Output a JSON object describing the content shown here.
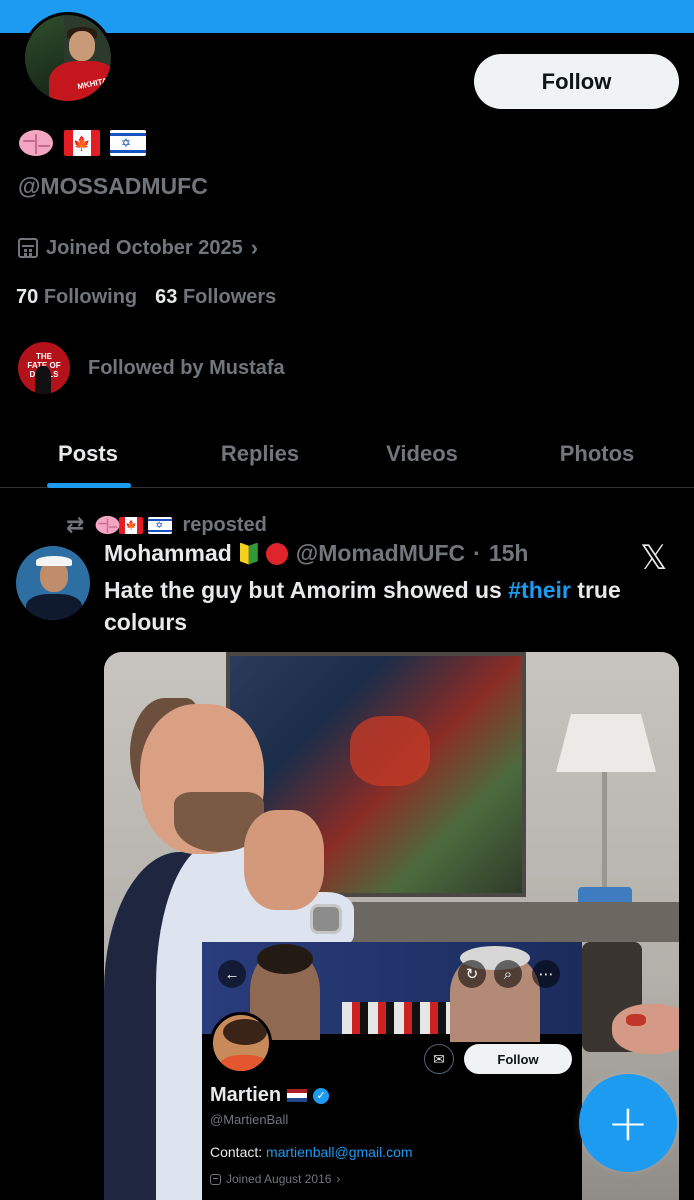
{
  "profile": {
    "display_emojis": [
      "brain",
      "canada-flag",
      "israel-flag"
    ],
    "handle": "@MOSSADMUFC",
    "avatar_shirt_text": "MKHITARYAN",
    "follow_label": "Follow",
    "joined": "Joined October 2025",
    "following_count": "70",
    "following_label": "Following",
    "followers_count": "63",
    "followers_label": "Followers",
    "followed_by": "Followed by Mustafa",
    "followed_by_avatar_text": "THE FATE OF DEVILS"
  },
  "tabs": [
    {
      "label": "Posts",
      "active": true
    },
    {
      "label": "Replies",
      "active": false
    },
    {
      "label": "Videos",
      "active": false
    },
    {
      "label": "Photos",
      "active": false
    }
  ],
  "post": {
    "repost_label": "reposted",
    "author_name": "Mohammad",
    "author_handle": "@MomadMUFC",
    "separator": "·",
    "time": "15h",
    "text_before": "Hate the guy but Amorim showed us ",
    "hashtag": "#their",
    "text_after": " true colours",
    "embedded_profile": {
      "name": "Martien",
      "handle": "@MartienBall",
      "contact_label": "Contact: ",
      "contact_email": "martienball@gmail.com",
      "joined": "Joined August 2016",
      "follow_label": "Follow"
    }
  },
  "colors": {
    "accent": "#1d9bf0",
    "background": "#000000",
    "secondary_text": "#71767b",
    "primary_text": "#e7e9ea"
  },
  "fab": {
    "icon": "plus-icon",
    "label": "+"
  }
}
